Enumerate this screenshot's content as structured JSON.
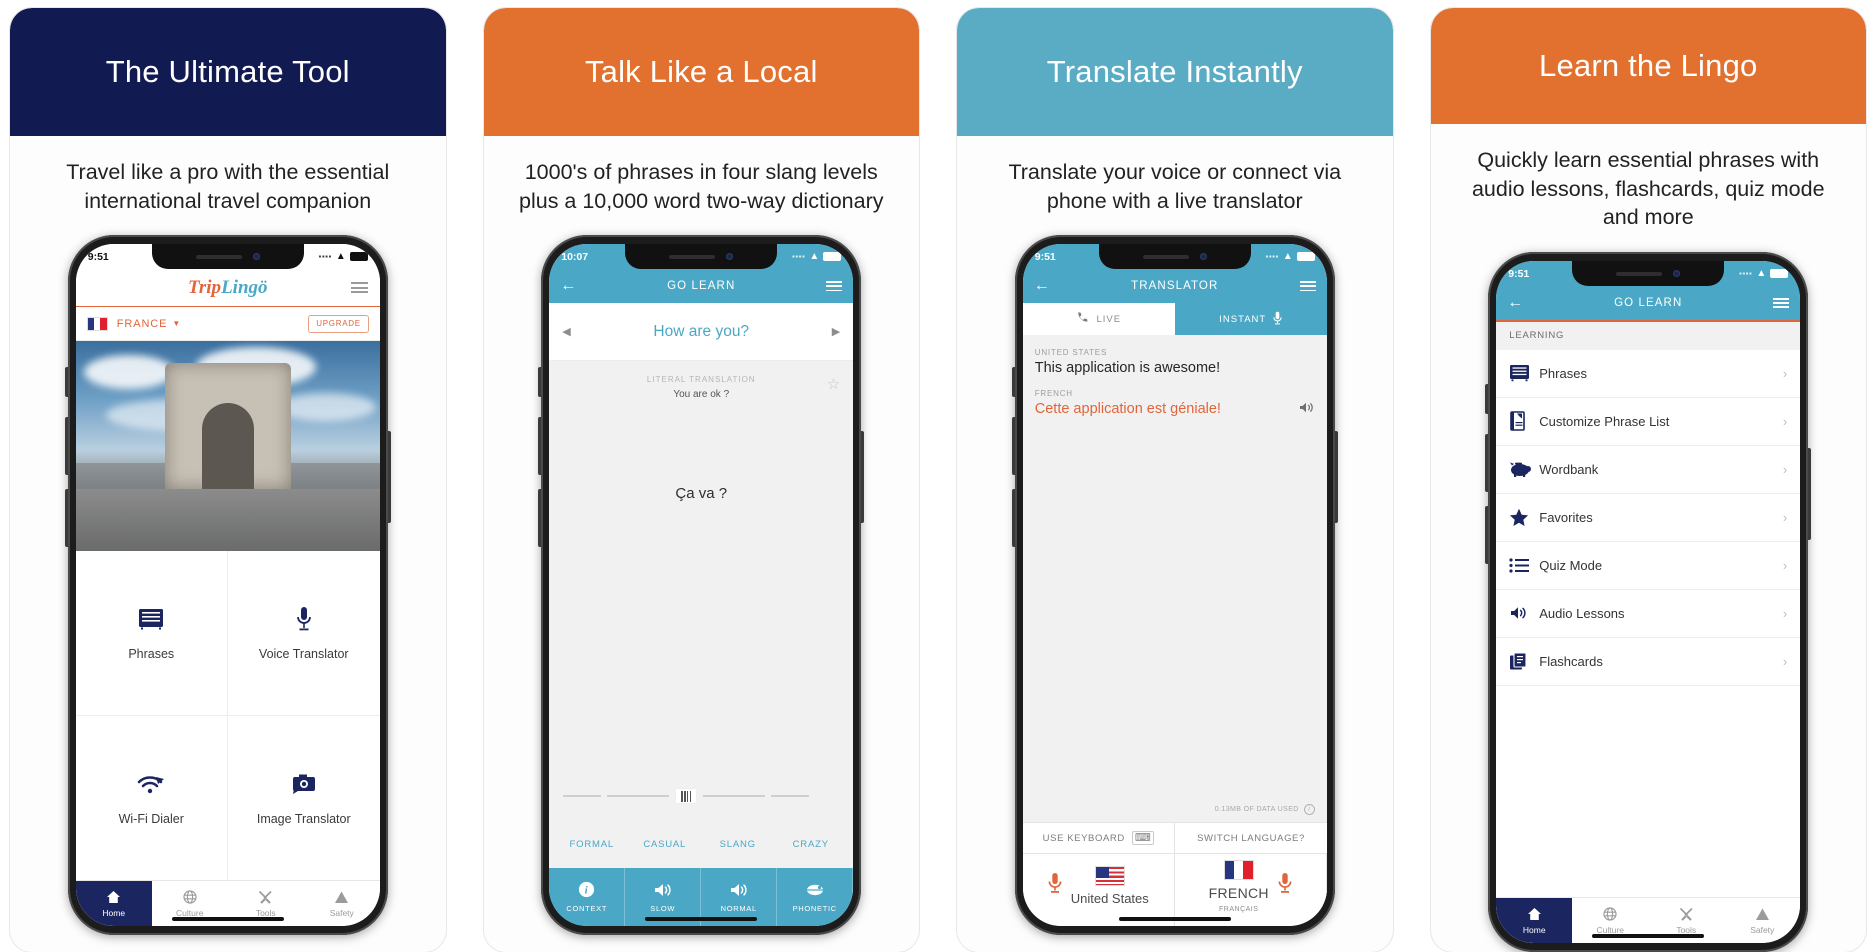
{
  "colors": {
    "navy": "#121a52",
    "orange": "#e2702f",
    "blue": "#5aabc4",
    "accent_orange": "#e2653a",
    "accent_blue": "#4aa8c6",
    "icon_navy": "#1b2560"
  },
  "cards": [
    {
      "banner_title": "The Ultimate Tool",
      "banner_color": "#121a52",
      "subtitle": "Travel like a pro with the essential international travel companion"
    },
    {
      "banner_title": "Talk Like a Local",
      "banner_color": "#e2702f",
      "subtitle": "1000's of phrases in four slang levels plus a 10,000 word two-way dictionary"
    },
    {
      "banner_title": "Translate Instantly",
      "banner_color": "#5aabc4",
      "subtitle": "Translate your voice or connect via phone with a live translator"
    },
    {
      "banner_title": "Learn the Lingo",
      "banner_color": "#e2702f",
      "subtitle": "Quickly learn essential phrases with audio lessons, flashcards, quiz mode and more"
    }
  ],
  "screen1": {
    "status_time": "9:51",
    "logo_part1": "Trip",
    "logo_part2": "Lingö",
    "country": "FRANCE",
    "upgrade_label": "UPGRADE",
    "tiles": [
      {
        "label": "Phrases",
        "icon": "phrases-icon"
      },
      {
        "label": "Voice Translator",
        "icon": "microphone-icon"
      },
      {
        "label": "Wi-Fi Dialer",
        "icon": "wifi-dialer-icon"
      },
      {
        "label": "Image Translator",
        "icon": "camera-icon"
      }
    ],
    "tabs": [
      {
        "label": "Home",
        "icon": "home-icon",
        "active": true
      },
      {
        "label": "Culture",
        "icon": "globe-icon",
        "active": false
      },
      {
        "label": "Tools",
        "icon": "tools-icon",
        "active": false
      },
      {
        "label": "Safety",
        "icon": "warning-icon",
        "active": false
      }
    ]
  },
  "screen2": {
    "status_time": "10:07",
    "nav_title": "GO LEARN",
    "phrase": "How are you?",
    "literal_label": "LITERAL TRANSLATION",
    "literal_text": "You are ok ?",
    "translation": "Ça va ?",
    "slider_labels": [
      "FORMAL",
      "CASUAL",
      "SLANG",
      "CRAZY"
    ],
    "actions": [
      {
        "label": "CONTEXT",
        "icon": "info-icon"
      },
      {
        "label": "SLOW",
        "icon": "speaker-icon"
      },
      {
        "label": "NORMAL",
        "icon": "speaker-icon"
      },
      {
        "label": "PHONETIC",
        "icon": "mouth-icon"
      }
    ]
  },
  "screen3": {
    "status_time": "9:51",
    "nav_title": "TRANSLATOR",
    "tabs": [
      {
        "label": "LIVE",
        "icon": "phone-icon",
        "active": true
      },
      {
        "label": "INSTANT",
        "icon": "microphone-icon",
        "active": false
      }
    ],
    "source_lang_label": "UNITED STATES",
    "source_text": "This application is awesome!",
    "target_lang_label": "FRENCH",
    "target_text": "Cette application est géniale!",
    "data_used": "0.13MB OF DATA USED",
    "use_keyboard": "USE KEYBOARD",
    "switch_language": "SWITCH LANGUAGE?",
    "left_lang": "United States",
    "right_lang": "FRENCH",
    "right_lang_sub": "FRANÇAIS"
  },
  "screen4": {
    "status_time": "9:51",
    "nav_title": "GO LEARN",
    "section_header": "LEARNING",
    "items": [
      {
        "label": "Phrases",
        "icon": "phrases-icon"
      },
      {
        "label": "Customize Phrase List",
        "icon": "notebook-icon"
      },
      {
        "label": "Wordbank",
        "icon": "piggy-bank-icon"
      },
      {
        "label": "Favorites",
        "icon": "star-icon"
      },
      {
        "label": "Quiz Mode",
        "icon": "list-icon"
      },
      {
        "label": "Audio Lessons",
        "icon": "speaker-icon"
      },
      {
        "label": "Flashcards",
        "icon": "flashcards-icon"
      }
    ],
    "tabs": [
      {
        "label": "Home",
        "icon": "home-icon",
        "active": true
      },
      {
        "label": "Culture",
        "icon": "globe-icon",
        "active": false
      },
      {
        "label": "Tools",
        "icon": "tools-icon",
        "active": false
      },
      {
        "label": "Safety",
        "icon": "warning-icon",
        "active": false
      }
    ]
  }
}
